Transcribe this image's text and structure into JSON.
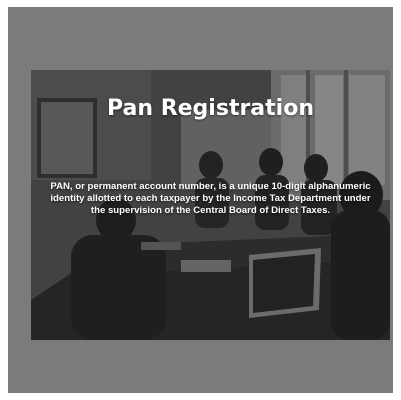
{
  "banner": {
    "title": "Pan Registration",
    "description": "PAN, or permanent account number, is a unique 10-digit alphanumeric identity allotted to each taxpayer by the Income Tax Department under the supervision of the Central Board of Direct Taxes."
  },
  "colors": {
    "frame": "#7b7b7b",
    "text": "#ffffff"
  },
  "image": {
    "subject": "meeting-room-photo"
  }
}
